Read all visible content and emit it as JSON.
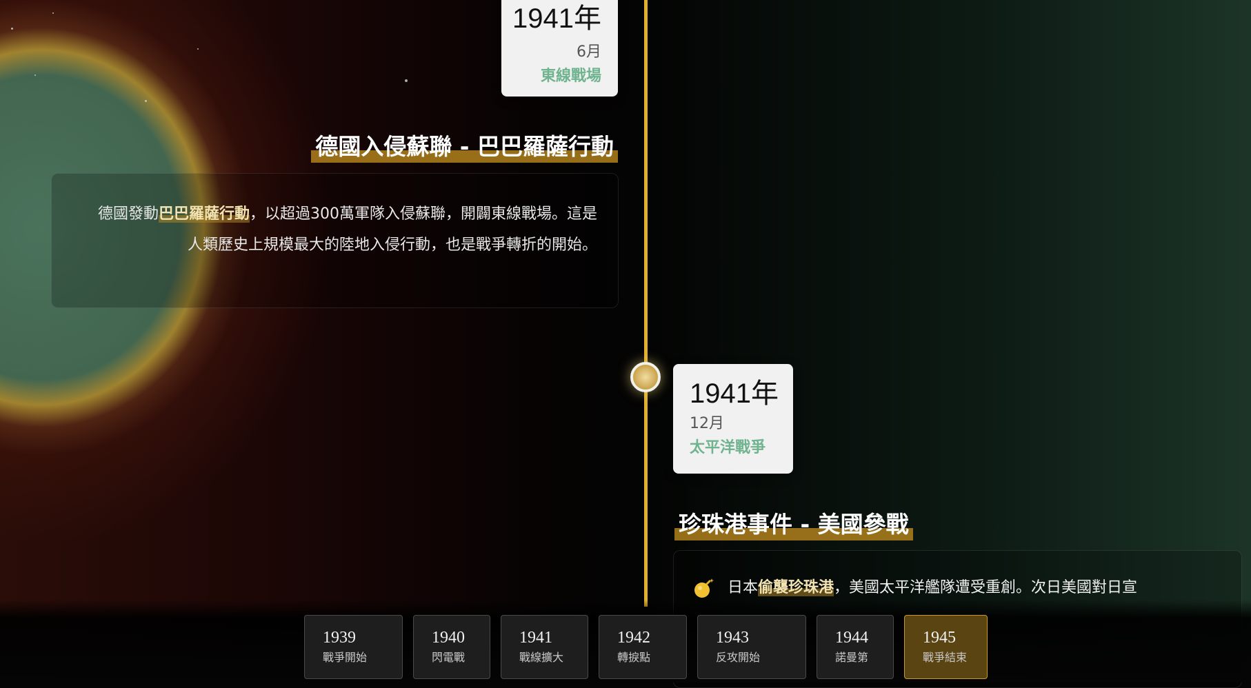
{
  "events": [
    {
      "year": "1941年",
      "month": "6月",
      "category": "東線戰場",
      "title": "德國入侵蘇聯 - 巴巴羅薩行動",
      "desc_pre": "德國發動",
      "desc_keyword": "巴巴羅薩行動",
      "desc_post": "，以超過300萬軍隊入侵蘇聯，開闢東線戰場。這是人類歷史上規模最大的陸地入侵行動，也是戰爭轉折的開始。"
    },
    {
      "year": "1941年",
      "month": "12月",
      "category": "太平洋戰爭",
      "title": "珍珠港事件 - 美國參戰",
      "icon": "bomb-icon",
      "desc_pre": "日本",
      "desc_keyword": "偷襲珍珠港",
      "desc_post": "，美國太平洋艦隊遭受重創。次日美國對日宣"
    }
  ],
  "year_nav": [
    {
      "year": "1939",
      "label": "戰爭開始",
      "active": false
    },
    {
      "year": "1940",
      "label": "閃電戰",
      "active": false
    },
    {
      "year": "1941",
      "label": "戰線擴大",
      "active": false
    },
    {
      "year": "1942",
      "label": "轉捩點",
      "active": false
    },
    {
      "year": "1943",
      "label": "反攻開始",
      "active": false
    },
    {
      "year": "1944",
      "label": "諾曼第",
      "active": false
    },
    {
      "year": "1945",
      "label": "戰爭結束",
      "active": true
    }
  ],
  "colors": {
    "timeline": "#e3b02c",
    "category": "#6fb38f",
    "active_nav": "#5a4412",
    "active_border": "#c99a2e"
  }
}
